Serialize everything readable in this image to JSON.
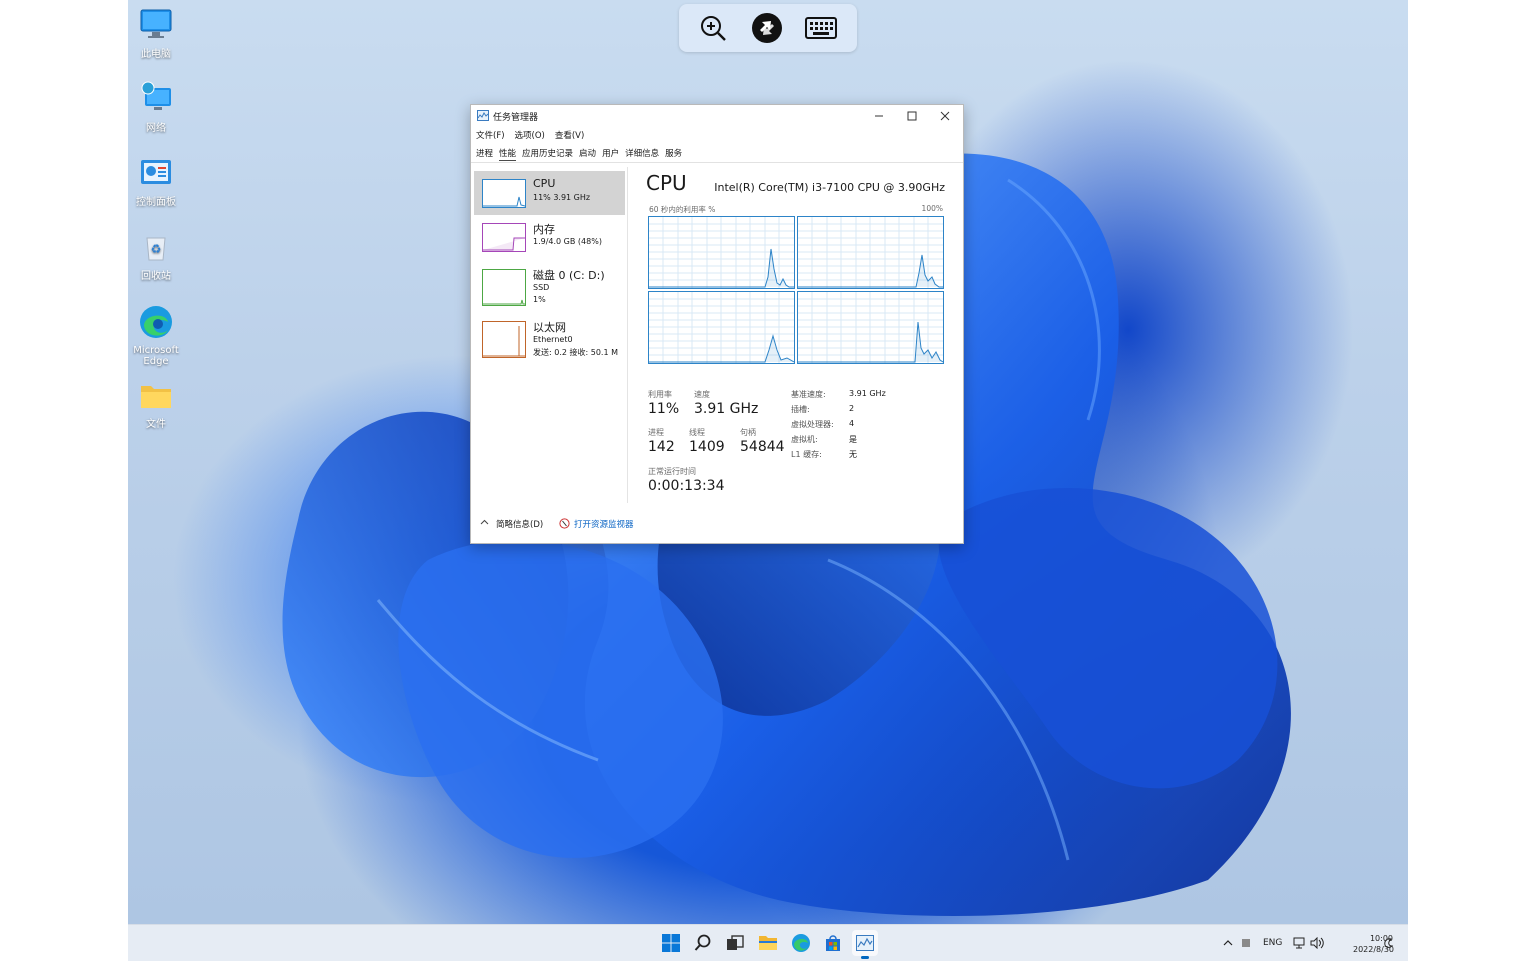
{
  "desktop": {
    "icons": [
      {
        "label": "此电脑"
      },
      {
        "label": "网络"
      },
      {
        "label": "控制面板"
      },
      {
        "label": "回收站"
      },
      {
        "label": "Microsoft Edge"
      },
      {
        "label": "文件"
      }
    ]
  },
  "remote_toolbar": {
    "icons": [
      "zoom-in-icon",
      "remote-connection-icon",
      "keyboard-icon"
    ]
  },
  "task_manager": {
    "title": "任务管理器",
    "menu": [
      "文件(F)",
      "选项(O)",
      "查看(V)"
    ],
    "tabs": [
      "进程",
      "性能",
      "应用历史记录",
      "启动",
      "用户",
      "详细信息",
      "服务"
    ],
    "selected_tab": "性能",
    "resources": [
      {
        "name": "CPU",
        "line1": "11%  3.91 GHz",
        "line2": "",
        "color": "#2d84c8"
      },
      {
        "name": "内存",
        "line1": "1.9/4.0 GB (48%)",
        "line2": "",
        "color": "#a546b8"
      },
      {
        "name": "磁盘 0 (C: D:)",
        "line1": "SSD",
        "line2": "1%",
        "color": "#4da744"
      },
      {
        "name": "以太网",
        "line1": "Ethernet0",
        "line2": "发送: 0.2  接收: 50.1 M",
        "color": "#c0652a"
      }
    ],
    "detail": {
      "title": "CPU",
      "model": "Intel(R) Core(TM) i3-7100 CPU @ 3.90GHz",
      "graph_caption": "60 秒内的利用率 %",
      "graph_max": "100%",
      "stats": {
        "utilization_label": "利用率",
        "utilization": "11%",
        "speed_label": "速度",
        "speed": "3.91 GHz",
        "processes_label": "进程",
        "processes": "142",
        "threads_label": "线程",
        "threads": "1409",
        "handles_label": "句柄",
        "handles": "54844",
        "uptime_label": "正常运行时间",
        "uptime": "0:00:13:34"
      },
      "properties": [
        {
          "label": "基准速度:",
          "value": "3.91 GHz"
        },
        {
          "label": "插槽:",
          "value": "2"
        },
        {
          "label": "虚拟处理器:",
          "value": "4"
        },
        {
          "label": "虚拟机:",
          "value": "是"
        },
        {
          "label": "L1 缓存:",
          "value": "无"
        }
      ]
    },
    "footer": {
      "brief": "简略信息(D)",
      "resource_monitor": "打开资源监视器"
    }
  },
  "taskbar": {
    "apps": [
      "start-icon",
      "search-icon",
      "task-view-icon",
      "file-explorer-icon",
      "edge-icon",
      "store-icon",
      "task-manager-icon"
    ],
    "language": "ENG",
    "time": "10:00",
    "date": "2022/8/30"
  }
}
